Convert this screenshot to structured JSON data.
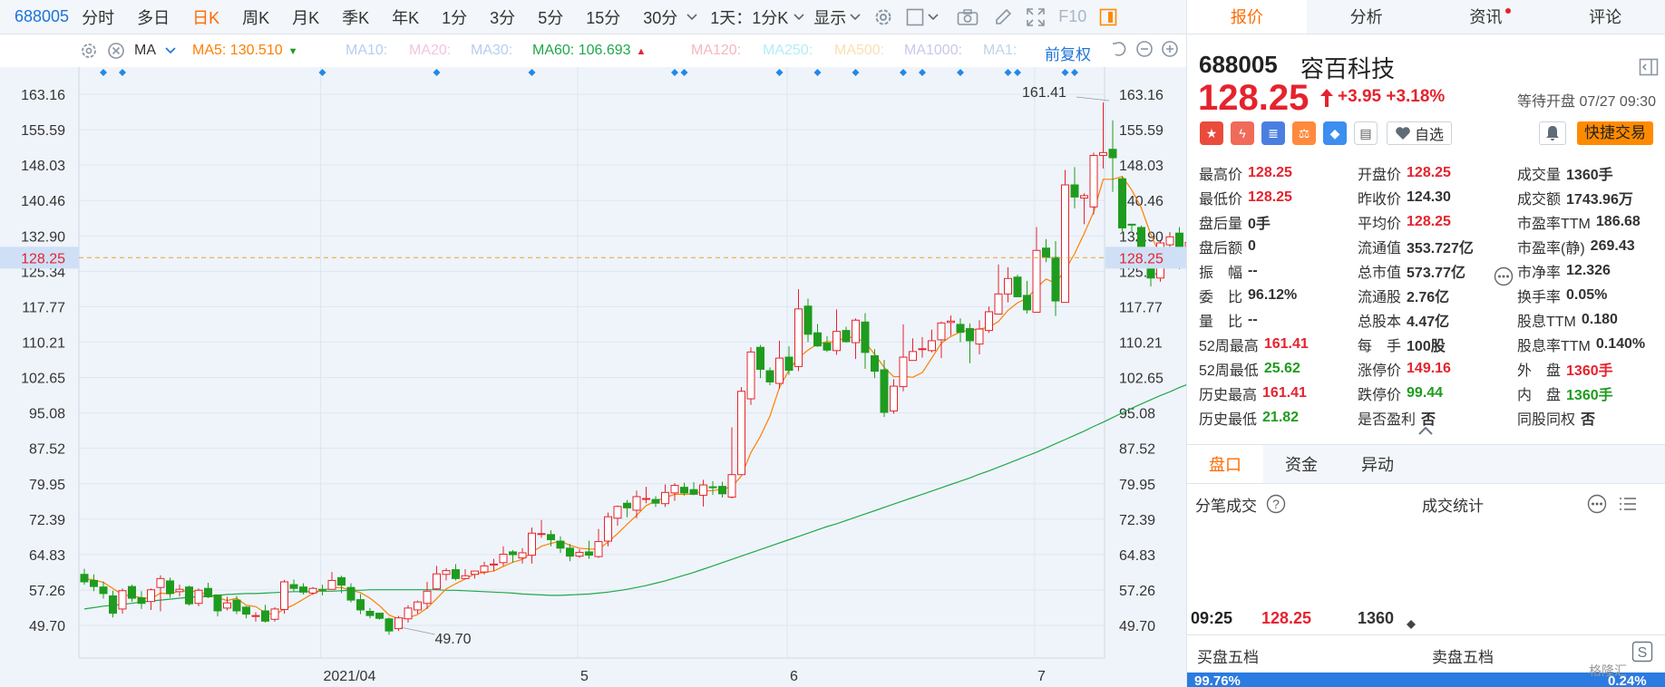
{
  "toolbar": {
    "code": "688005",
    "periods": [
      "分时",
      "多日",
      "日K",
      "周K",
      "月K",
      "季K",
      "年K",
      "1分",
      "3分",
      "5分",
      "15分",
      "30分"
    ],
    "active_period": "日K",
    "time_setting": "1天：1分K",
    "display_label": "显示",
    "f10_label": "F10"
  },
  "ma_bar": {
    "indicator": "MA",
    "items": [
      {
        "label": "MA5: 130.510",
        "color": "#ff7f00",
        "arrow": "down"
      },
      {
        "label": "MA10:",
        "color": "#b7cdf3"
      },
      {
        "label": "MA20:",
        "color": "#f5c3df"
      },
      {
        "label": "MA30:",
        "color": "#b7cdf3"
      },
      {
        "label": "MA60: 106.693",
        "color": "#1fa84a",
        "arrow": "up"
      },
      {
        "label": "MA120:",
        "color": "#f8b5c0"
      },
      {
        "label": "MA250:",
        "color": "#b3ecf7"
      },
      {
        "label": "MA500:",
        "color": "#f9e0b0"
      },
      {
        "label": "MA1000:",
        "color": "#c7c8ee"
      },
      {
        "label": "MA1:",
        "color": "#c0d3ea"
      }
    ],
    "restore_label": "前复权"
  },
  "chart_data": {
    "type": "candlestick",
    "y_ticks": [
      "163.16",
      "155.59",
      "148.03",
      "140.46",
      "132.90",
      "125.34",
      "117.77",
      "110.21",
      "102.65",
      "95.08",
      "87.52",
      "79.95",
      "72.39",
      "64.83",
      "57.26",
      "49.70"
    ],
    "ylim": [
      49.7,
      163.16
    ],
    "x_labels": [
      {
        "index": 25,
        "label": "2021/04"
      },
      {
        "index": 52,
        "label": "5"
      },
      {
        "index": 74,
        "label": "6"
      },
      {
        "index": 100,
        "label": "7"
      }
    ],
    "current_price": 128.25,
    "current_price_label": "128.25",
    "high_annotation": {
      "index": 108,
      "value": 161.41,
      "label": "161.41"
    },
    "low_annotation": {
      "index": 33,
      "value": 49.7,
      "label": "49.70"
    },
    "event_marker_indices": [
      2,
      4,
      25,
      37,
      47,
      62,
      63,
      73,
      77,
      81,
      86,
      88,
      92,
      97,
      98,
      103,
      104,
      118,
      120
    ],
    "candles": [
      [
        60.6,
        59.0,
        61.8,
        58.4
      ],
      [
        59.3,
        58.0,
        60.6,
        57.0
      ],
      [
        57.9,
        56.5,
        59.1,
        55.4
      ],
      [
        56.0,
        52.3,
        57.1,
        51.4
      ],
      [
        53.2,
        57.1,
        57.6,
        52.2
      ],
      [
        58.0,
        55.5,
        58.4,
        54.7
      ],
      [
        55.6,
        54.4,
        57.0,
        53.2
      ],
      [
        54.8,
        57.3,
        57.6,
        53.0
      ],
      [
        57.8,
        59.7,
        60.4,
        52.7
      ],
      [
        59.2,
        56.5,
        59.9,
        55.6
      ],
      [
        56.9,
        57.4,
        58.4,
        55.9
      ],
      [
        57.9,
        54.3,
        58.2,
        53.9
      ],
      [
        54.4,
        57.2,
        57.6,
        53.8
      ],
      [
        57.6,
        55.8,
        58.8,
        55.5
      ],
      [
        56.2,
        52.8,
        56.3,
        51.6
      ],
      [
        53.4,
        54.5,
        55.8,
        52.9
      ],
      [
        55.1,
        52.8,
        56.0,
        52.1
      ],
      [
        53.6,
        52.1,
        53.8,
        51.2
      ],
      [
        51.6,
        51.8,
        52.5,
        50.5
      ],
      [
        52.8,
        50.6,
        54.1,
        50.3
      ],
      [
        51.0,
        53.2,
        53.6,
        50.5
      ],
      [
        53.1,
        59.0,
        59.4,
        52.2
      ],
      [
        58.4,
        57.6,
        59.5,
        57.0
      ],
      [
        57.9,
        56.8,
        58.7,
        56.3
      ],
      [
        56.6,
        57.6,
        57.9,
        56.2
      ],
      [
        57.4,
        57.2,
        58.4,
        56.1
      ],
      [
        57.4,
        59.3,
        61.1,
        57.3
      ],
      [
        59.9,
        58.3,
        60.3,
        56.6
      ],
      [
        57.8,
        55.1,
        58.7,
        54.6
      ],
      [
        55.2,
        53.0,
        56.4,
        52.1
      ],
      [
        52.7,
        51.8,
        53.4,
        51.2
      ],
      [
        52.3,
        51.2,
        52.4,
        50.9
      ],
      [
        51.1,
        48.5,
        51.4,
        47.7
      ],
      [
        49.0,
        51.3,
        51.7,
        48.5
      ],
      [
        51.1,
        53.4,
        54.0,
        50.3
      ],
      [
        53.0,
        54.7,
        55.0,
        52.2
      ],
      [
        54.4,
        57.0,
        59.0,
        53.2
      ],
      [
        57.5,
        60.7,
        62.4,
        57.2
      ],
      [
        60.6,
        61.4,
        61.9,
        59.3
      ],
      [
        61.6,
        59.7,
        62.8,
        59.3
      ],
      [
        59.7,
        60.3,
        61.7,
        59.7
      ],
      [
        60.6,
        61.3,
        61.3,
        59.7
      ],
      [
        61.1,
        62.4,
        63.3,
        60.6
      ],
      [
        62.6,
        62.8,
        63.9,
        61.3
      ],
      [
        63.1,
        64.9,
        66.6,
        62.4
      ],
      [
        65.4,
        64.8,
        65.8,
        63.1
      ],
      [
        64.1,
        65.2,
        66.2,
        62.9
      ],
      [
        64.7,
        69.4,
        70.6,
        62.9
      ],
      [
        69.3,
        69.3,
        72.2,
        68.4
      ],
      [
        69.1,
        68.0,
        70.0,
        66.6
      ],
      [
        67.7,
        66.2,
        68.7,
        65.2
      ],
      [
        66.2,
        64.5,
        67.1,
        63.4
      ],
      [
        64.5,
        65.3,
        66.0,
        64.1
      ],
      [
        65.4,
        64.7,
        67.8,
        63.9
      ],
      [
        64.4,
        67.6,
        70.3,
        64.1
      ],
      [
        67.7,
        72.9,
        73.8,
        66.6
      ],
      [
        72.6,
        75.1,
        75.3,
        71.0
      ],
      [
        75.8,
        74.8,
        76.5,
        72.8
      ],
      [
        74.3,
        77.2,
        78.5,
        72.6
      ],
      [
        76.8,
        76.8,
        79.3,
        75.8
      ],
      [
        76.6,
        75.8,
        77.3,
        75.0
      ],
      [
        75.7,
        78.1,
        79.8,
        75.0
      ],
      [
        78.0,
        79.6,
        80.1,
        76.3
      ],
      [
        79.2,
        78.0,
        80.2,
        77.4
      ],
      [
        78.7,
        77.7,
        80.3,
        77.5
      ],
      [
        77.5,
        79.7,
        80.8,
        75.1
      ],
      [
        79.3,
        79.1,
        80.5,
        77.6
      ],
      [
        79.4,
        77.8,
        80.4,
        77.0
      ],
      [
        77.1,
        81.9,
        92.0,
        76.8
      ],
      [
        81.9,
        99.7,
        100.6,
        81.9
      ],
      [
        98.1,
        108.1,
        109.1,
        96.8
      ],
      [
        109.1,
        104.4,
        109.6,
        102.5
      ],
      [
        104.1,
        101.7,
        104.8,
        101.0
      ],
      [
        101.4,
        106.8,
        110.5,
        100.2
      ],
      [
        107.0,
        104.2,
        109.3,
        103.2
      ],
      [
        105.0,
        117.3,
        121.5,
        104.0
      ],
      [
        117.9,
        111.9,
        119.5,
        110.2
      ],
      [
        112.2,
        109.4,
        114.1,
        109.2
      ],
      [
        110.0,
        108.5,
        111.5,
        108.1
      ],
      [
        108.4,
        112.5,
        117.2,
        107.5
      ],
      [
        112.7,
        110.3,
        113.5,
        110.1
      ],
      [
        110.1,
        114.9,
        115.3,
        106.6
      ],
      [
        114.5,
        108.0,
        116.4,
        104.5
      ],
      [
        107.3,
        104.0,
        108.7,
        102.5
      ],
      [
        104.3,
        95.2,
        106.4,
        94.2
      ],
      [
        95.5,
        100.8,
        102.3,
        94.9
      ],
      [
        100.7,
        107.0,
        114.0,
        99.7
      ],
      [
        106.3,
        108.2,
        111.0,
        106.3
      ],
      [
        108.8,
        108.8,
        111.3,
        106.9
      ],
      [
        108.4,
        110.5,
        112.9,
        108.0
      ],
      [
        110.7,
        114.3,
        114.6,
        106.8
      ],
      [
        114.4,
        114.7,
        115.9,
        111.6
      ],
      [
        114.0,
        112.3,
        115.3,
        110.2
      ],
      [
        113.1,
        110.5,
        114.2,
        105.7
      ],
      [
        109.8,
        113.0,
        114.9,
        107.6
      ],
      [
        112.7,
        116.7,
        117.8,
        112.2
      ],
      [
        116.2,
        120.5,
        126.8,
        116.2
      ],
      [
        120.5,
        123.8,
        126.2,
        118.7
      ],
      [
        124.1,
        119.9,
        124.6,
        119.8
      ],
      [
        120.2,
        117.1,
        123.3,
        116.3
      ],
      [
        116.6,
        129.8,
        134.8,
        116.6
      ],
      [
        130.3,
        128.3,
        132.2,
        127.3
      ],
      [
        128.3,
        119.0,
        131.8,
        115.8
      ],
      [
        118.7,
        143.8,
        147.0,
        118.7
      ],
      [
        143.8,
        141.2,
        147.6,
        138.8
      ],
      [
        141.0,
        141.5,
        142.0,
        135.4
      ],
      [
        139.1,
        150.1,
        150.7,
        137.5
      ],
      [
        150.1,
        150.7,
        161.4,
        147.3
      ],
      [
        151.4,
        149.6,
        157.6,
        142.3
      ],
      [
        145.1,
        134.6,
        145.6,
        133.5
      ],
      [
        135.4,
        135.2,
        135.5,
        133.6
      ],
      [
        134.7,
        127.5,
        135.1,
        127.0
      ],
      [
        126.4,
        123.9,
        128.7,
        122.1
      ],
      [
        123.9,
        131.4,
        131.8,
        123.1
      ],
      [
        131.0,
        132.7,
        133.7,
        128.6
      ],
      [
        133.5,
        126.7,
        134.8,
        125.8
      ],
      [
        126.9,
        131.5,
        135.3,
        126.6
      ],
      [
        131.8,
        130.0,
        140.7,
        129.4
      ],
      [
        138.4,
        131.0,
        140.2,
        130.3
      ],
      [
        132.8,
        124.3,
        134.1,
        117.7
      ]
    ],
    "ma5": [
      59.7,
      59.4,
      58.9,
      57.6,
      56.2,
      56.0,
      55.6,
      55.4,
      56.6,
      56.4,
      57.1,
      57.0,
      56.9,
      56.2,
      55.6,
      55.0,
      55.5,
      54.0,
      53.7,
      52.4,
      51.9,
      53.2,
      54.1,
      55.3,
      56.5,
      57.2,
      57.7,
      57.8,
      57.2,
      56.7,
      55.5,
      53.9,
      51.9,
      51.1,
      51.3,
      52.0,
      53.4,
      55.4,
      57.5,
      58.6,
      59.6,
      60.7,
      61.0,
      61.3,
      62.3,
      63.2,
      63.8,
      65.3,
      66.6,
      67.2,
      67.7,
      66.8,
      66.2,
      66.0,
      66.0,
      67.5,
      69.3,
      71.3,
      73.2,
      75.3,
      76.2,
      77.0,
      77.7,
      77.7,
      77.8,
      78.4,
      78.5,
      78.8,
      79.3,
      81.6,
      86.6,
      90.1,
      94.4,
      100.5,
      104.2,
      106.9,
      108.5,
      109.8,
      110.3,
      110.2,
      111.4,
      111.1,
      110.2,
      107.6,
      104.8,
      102.8,
      102.9,
      102.7,
      103.7,
      106.8,
      110.0,
      111.4,
      112.4,
      112.8,
      113.0,
      113.4,
      114.6,
      117.0,
      118.6,
      119.6,
      121.8,
      123.7,
      122.8,
      125.6,
      129.1,
      133.4,
      138.0,
      145.0,
      145.0,
      145.6,
      142.7,
      138.9,
      133.2,
      128.7,
      128.5,
      128.6,
      129.2,
      130.7,
      131.3,
      130.5,
      129.9
    ],
    "ma60": [
      53.2,
      53.5,
      53.8,
      54.0,
      54.2,
      54.4,
      54.7,
      54.9,
      55.1,
      55.3,
      55.5,
      55.7,
      55.8,
      56.0,
      56.1,
      56.3,
      56.4,
      56.5,
      56.5,
      56.6,
      56.7,
      56.8,
      56.9,
      56.9,
      56.9,
      57.0,
      57.0,
      57.1,
      57.2,
      57.2,
      57.3,
      57.3,
      57.3,
      57.3,
      57.3,
      57.3,
      57.3,
      57.3,
      57.2,
      57.2,
      57.1,
      57.0,
      56.9,
      56.8,
      56.7,
      56.6,
      56.4,
      56.3,
      56.2,
      56.1,
      56.1,
      56.2,
      56.3,
      56.4,
      56.6,
      56.8,
      57.1,
      57.4,
      57.8,
      58.2,
      58.7,
      59.2,
      59.8,
      60.4,
      61.0,
      61.7,
      62.4,
      63.1,
      63.8,
      64.5,
      65.2,
      65.9,
      66.6,
      67.3,
      68.0,
      68.7,
      69.4,
      70.1,
      70.8,
      71.4,
      72.1,
      72.8,
      73.5,
      74.2,
      74.9,
      75.6,
      76.3,
      77.0,
      77.7,
      78.4,
      79.1,
      79.8,
      80.5,
      81.2,
      82.0,
      82.7,
      83.5,
      84.3,
      85.1,
      85.9,
      86.7,
      87.6,
      88.5,
      89.4,
      90.3,
      91.2,
      92.2,
      93.1,
      94.1,
      95.1,
      96.1,
      97.0,
      97.9,
      98.8,
      99.6,
      100.5,
      101.3,
      102.2,
      103.0,
      103.8,
      104.6,
      105.6,
      106.7
    ]
  },
  "right_panel": {
    "tabs": [
      "报价",
      "分析",
      "资讯",
      "评论"
    ],
    "active_tab": "报价",
    "code": "688005",
    "name": "容百科技",
    "price": "128.25",
    "change": "+3.95 +3.18%",
    "status": "等待开盘 07/27 09:30",
    "watch_label": "自选",
    "trade_label": "快捷交易",
    "quote_cols": [
      [
        {
          "label": "最高价",
          "value": "128.25",
          "color": "red"
        },
        {
          "label": "最低价",
          "value": "128.25",
          "color": "red"
        },
        {
          "label": "盘后量",
          "value": "0手",
          "color": "dark"
        },
        {
          "label": "盘后额",
          "value": "0",
          "color": "dark"
        },
        {
          "label": "振　幅",
          "value": "--",
          "color": "dark"
        },
        {
          "label": "委　比",
          "value": "96.12%",
          "color": "dark"
        },
        {
          "label": "量　比",
          "value": "--",
          "color": "dark"
        },
        {
          "label": "52周最高",
          "value": "161.41",
          "color": "red"
        },
        {
          "label": "52周最低",
          "value": "25.62",
          "color": "green"
        },
        {
          "label": "历史最高",
          "value": "161.41",
          "color": "red"
        },
        {
          "label": "历史最低",
          "value": "21.82",
          "color": "green"
        }
      ],
      [
        {
          "label": "开盘价",
          "value": "128.25",
          "color": "red"
        },
        {
          "label": "昨收价",
          "value": "124.30",
          "color": "dark"
        },
        {
          "label": "平均价",
          "value": "128.25",
          "color": "red"
        },
        {
          "label": "流通值",
          "value": "353.727亿",
          "color": "dark"
        },
        {
          "label": "总市值",
          "value": "573.77亿",
          "color": "dark"
        },
        {
          "label": "流通股",
          "value": "2.76亿",
          "color": "dark"
        },
        {
          "label": "总股本",
          "value": "4.47亿",
          "color": "dark"
        },
        {
          "label": "每　手",
          "value": "100股",
          "color": "dark"
        },
        {
          "label": "涨停价",
          "value": "149.16",
          "color": "red"
        },
        {
          "label": "跌停价",
          "value": "99.44",
          "color": "green"
        },
        {
          "label": "是否盈利",
          "value": "否",
          "color": "dark"
        }
      ],
      [
        {
          "label": "成交量",
          "value": "1360手",
          "color": "dark"
        },
        {
          "label": "成交额",
          "value": "1743.96万",
          "color": "dark"
        },
        {
          "label": "市盈率TTM",
          "value": "186.68",
          "color": "dark"
        },
        {
          "label": "市盈率(静)",
          "value": "269.43",
          "color": "dark"
        },
        {
          "label": "市净率",
          "value": "12.326",
          "color": "dark"
        },
        {
          "label": "换手率",
          "value": "0.05%",
          "color": "dark"
        },
        {
          "label": "股息TTM",
          "value": "0.180",
          "color": "dark"
        },
        {
          "label": "股息率TTM",
          "value": "0.140%",
          "color": "dark"
        },
        {
          "label": "外　盘",
          "value": "1360手",
          "color": "red"
        },
        {
          "label": "内　盘",
          "value": "1360手",
          "color": "green"
        },
        {
          "label": "同股同权",
          "value": "否",
          "color": "dark"
        }
      ]
    ],
    "sub_tabs": [
      "盘口",
      "资金",
      "异动"
    ],
    "active_sub_tab": "盘口",
    "ticks_label": "分笔成交",
    "stats_label": "成交统计",
    "trade": {
      "time": "09:25",
      "price": "128.25",
      "volume": "1360"
    },
    "buy_label": "买盘五档",
    "sell_label": "卖盘五档",
    "buy_pct": "99.76%",
    "sell_pct": "0.24%",
    "watermark": "格隆汇"
  }
}
